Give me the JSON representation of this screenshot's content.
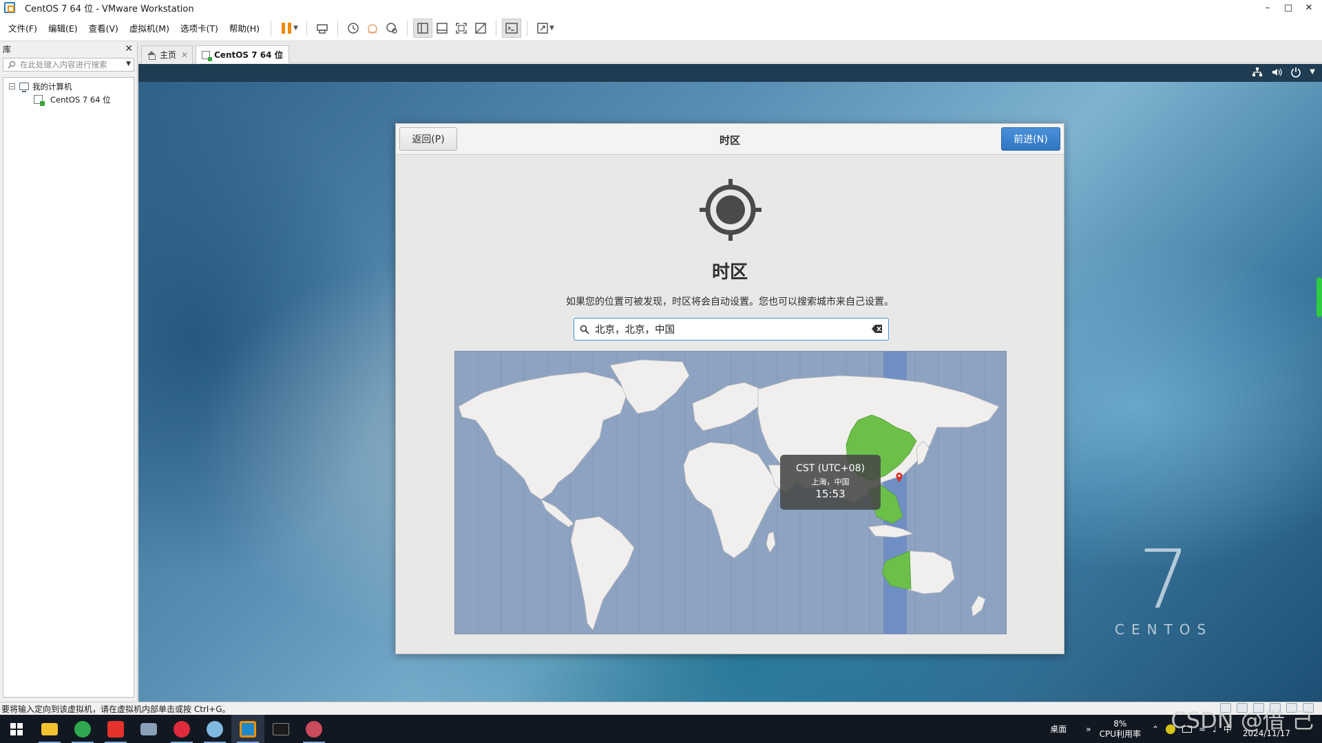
{
  "window": {
    "title": "CentOS 7 64 位 - VMware Workstation",
    "controls": [
      "minimize-icon",
      "maximize-icon",
      "close-icon"
    ]
  },
  "menu": {
    "items": [
      "文件(F)",
      "编辑(E)",
      "查看(V)",
      "虚拟机(M)",
      "选项卡(T)",
      "帮助(H)"
    ]
  },
  "toolbar": {
    "icons": [
      "pause-icon",
      "send-ctrl-alt-del-icon",
      "snapshot-icon",
      "revert-snapshot-icon",
      "snapshot-manager-icon",
      "library-view-icon",
      "thumbnail-view-icon",
      "fullscreen-icon",
      "unity-icon",
      "console-icon",
      "stretch-icon"
    ],
    "accent": "#f28a00"
  },
  "library": {
    "title": "库",
    "search_placeholder": "在此处键入内容进行搜索",
    "tree_root": "我的计算机",
    "tree_child": "CentOS 7 64 位"
  },
  "tabs": [
    {
      "label": "主页"
    },
    {
      "label": "CentOS 7 64 位"
    }
  ],
  "installer": {
    "back_label": "返回(P)",
    "header_title": "时区",
    "next_label": "前进(N)",
    "heading": "时区",
    "description": "如果您的位置可被发现，时区将会自动设置。您也可以搜索城市来自己设置。",
    "search_value": "北京，北京，中国",
    "tooltip": {
      "zone": "CST (UTC+08)",
      "city": "上海，中国",
      "time": "15:53"
    },
    "next_color": "#3b82cc",
    "map_color": "#8ea3c2",
    "highlight_color": "#6cc04a"
  },
  "branding": {
    "number": "7",
    "word": "CENTOS"
  },
  "statusbar": {
    "text": "要将输入定向到该虚拟机，请在虚拟机内部单击或按 Ctrl+G。"
  },
  "taskbar": {
    "desktop_label": "桌面",
    "cpu_value": "8%",
    "cpu_label": "CPU利用率",
    "ime": "中",
    "date": "2024/11/17"
  },
  "watermark": "CSDN @借 己"
}
